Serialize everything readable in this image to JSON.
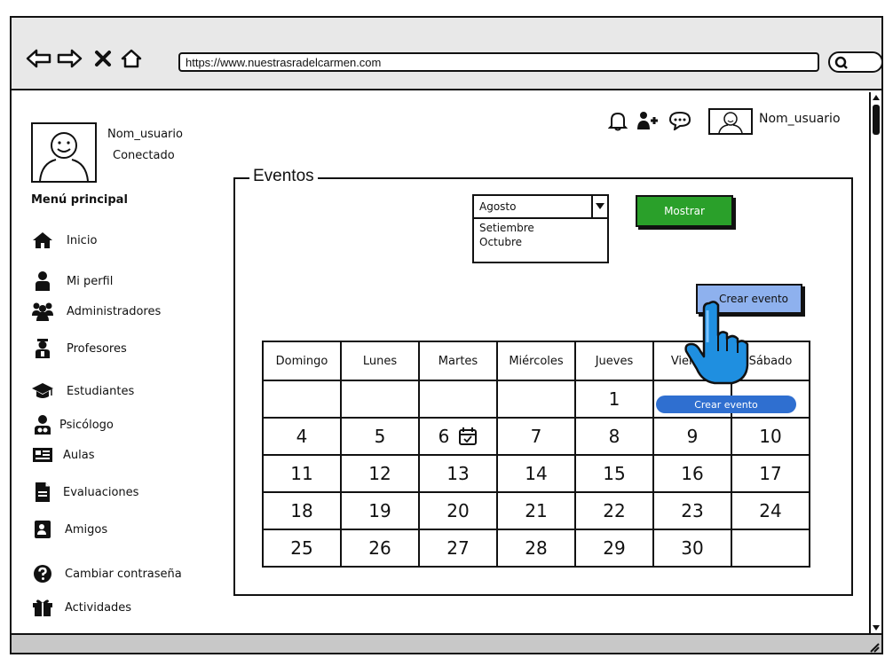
{
  "browser": {
    "url": "https://www.nuestrasradelcarmen.com"
  },
  "user": {
    "name": "Nom_usuario",
    "status": "Conectado"
  },
  "menu": {
    "title": "Menú principal",
    "items": [
      {
        "label": "Inicio",
        "icon": "home-icon"
      },
      {
        "label": "Mi perfil",
        "icon": "user-icon"
      },
      {
        "label": "Administradores",
        "icon": "group-icon"
      },
      {
        "label": "Profesores",
        "icon": "teacher-icon"
      },
      {
        "label": "Estudiantes",
        "icon": "graduation-cap-icon"
      },
      {
        "label": "Psicólogo",
        "icon": "psychologist-icon"
      },
      {
        "label": "Aulas",
        "icon": "classroom-icon"
      },
      {
        "label": "Evaluaciones",
        "icon": "document-icon"
      },
      {
        "label": "Amigos",
        "icon": "contacts-icon"
      },
      {
        "label": "Cambiar contraseña",
        "icon": "question-icon"
      },
      {
        "label": "Actividades",
        "icon": "gift-icon"
      }
    ]
  },
  "header": {
    "username": "Nom_usuario"
  },
  "events": {
    "legend": "Eventos",
    "month_select": {
      "selected": "Agosto",
      "options": [
        "Setiembre",
        "Octubre"
      ]
    },
    "show_button": "Mostrar",
    "create_button": "Crear evento",
    "create_pill": "Crear evento"
  },
  "calendar": {
    "weekdays": [
      "Domingo",
      "Lunes",
      "Martes",
      "Miércoles",
      "Jueves",
      "Viernes",
      "Sábado"
    ],
    "weeks": [
      [
        "",
        "",
        "",
        "",
        "1",
        "",
        ""
      ],
      [
        "4",
        "5",
        "6",
        "7",
        "8",
        "9",
        "10"
      ],
      [
        "11",
        "12",
        "13",
        "14",
        "15",
        "16",
        "17"
      ],
      [
        "18",
        "19",
        "20",
        "21",
        "22",
        "23",
        "24"
      ],
      [
        "25",
        "26",
        "27",
        "28",
        "29",
        "30",
        ""
      ]
    ],
    "event_day": "6"
  },
  "colors": {
    "show_button": "#2aa02a",
    "create_button": "#8eb1ee",
    "create_pill": "#2f6fd0",
    "hand_cursor": "#1f8fe0"
  }
}
